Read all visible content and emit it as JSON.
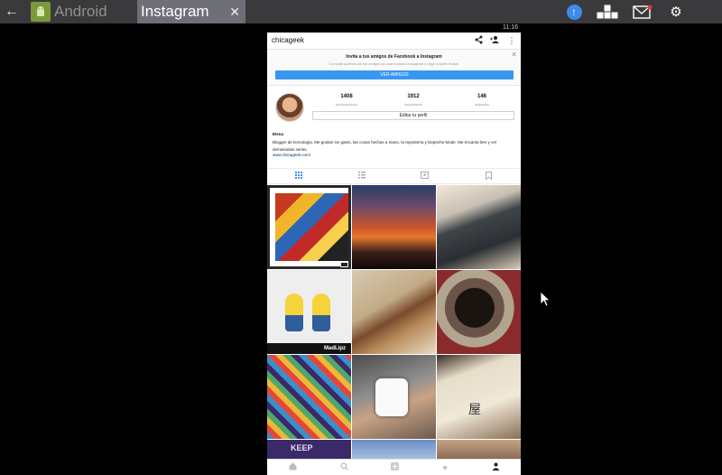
{
  "topbar": {
    "back_glyph": "←",
    "tab_android_label": "Android",
    "tab_instagram_label": "Instagram",
    "close_glyph": "✕",
    "clock": "11:16"
  },
  "profile": {
    "username": "chicageek",
    "banner_title": "Invita a tus amigos de Facebook a Instagram",
    "banner_subtitle": "Consulta quienes de tus amigos ya usan todavia Instagram y elige a quién invitar.",
    "banner_button": "VER AMIGOS",
    "stats": [
      {
        "value": "1408",
        "label": "publicaciones"
      },
      {
        "value": "1912",
        "label": "seguidores"
      },
      {
        "value": "146",
        "label": "seguidos"
      }
    ],
    "edit_button": "Editar tu perfil",
    "bio_name": "Elena",
    "bio_text": "Blogger de tecnología. Me gustan los gatos, las cosas hechas a mano, la repostería y Depeche Mode. Me encanta leer y ver demasiadas series.",
    "bio_link": "www.chicageek.com/",
    "madlipz_label": "MadLipz",
    "keep_label": "KEEP",
    "kanji": "屋"
  },
  "colors": {
    "accent": "#3897f0",
    "topbar": "#3a3a3c",
    "active_tab": "#6f6f78"
  }
}
